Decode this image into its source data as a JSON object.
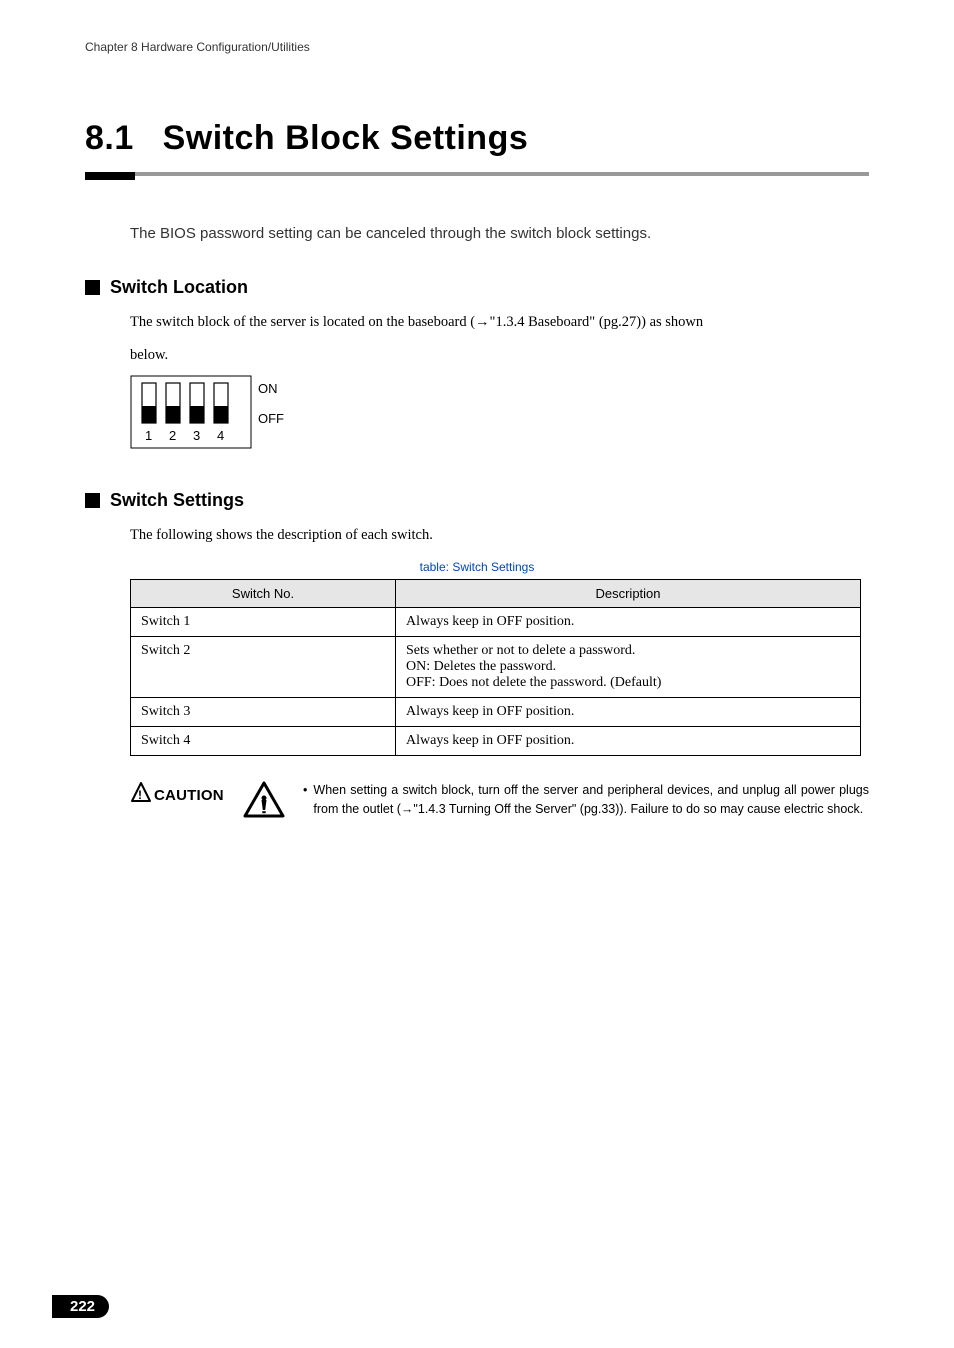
{
  "chapter_header": "Chapter 8  Hardware Configuration/Utilities",
  "section_number": "8.1",
  "section_title": "Switch Block Settings",
  "intro": "The BIOS password setting can be canceled through the switch block settings.",
  "subsection1_title": "Switch Location",
  "subsection1_body_a": "The switch block of the server is located on the baseboard (→\"1.3.4 Baseboard\" (pg.27)) as shown",
  "subsection1_body_b": "below.",
  "switch_labels": {
    "on": "ON",
    "off": "OFF",
    "n1": "1",
    "n2": "2",
    "n3": "3",
    "n4": "4"
  },
  "subsection2_title": "Switch Settings",
  "subsection2_body": "The following shows the description of each switch.",
  "table_caption": "table: Switch Settings",
  "table_headers": {
    "col1": "Switch No.",
    "col2": "Description"
  },
  "table_rows": [
    {
      "no": "Switch 1",
      "desc": "Always keep in OFF position."
    },
    {
      "no": "Switch 2",
      "desc": "Sets whether or not to delete a password.\nON: Deletes the password.\nOFF: Does not delete the password. (Default)"
    },
    {
      "no": "Switch 3",
      "desc": "Always keep in OFF position."
    },
    {
      "no": "Switch 4",
      "desc": "Always keep in OFF position."
    }
  ],
  "caution_label": "CAUTION",
  "caution_text": "When setting a switch block, turn off the server and peripheral devices, and unplug all power plugs from the outlet (→\"1.4.3 Turning Off the Server\" (pg.33)). Failure to do so may cause electric shock.",
  "page_number": "222"
}
